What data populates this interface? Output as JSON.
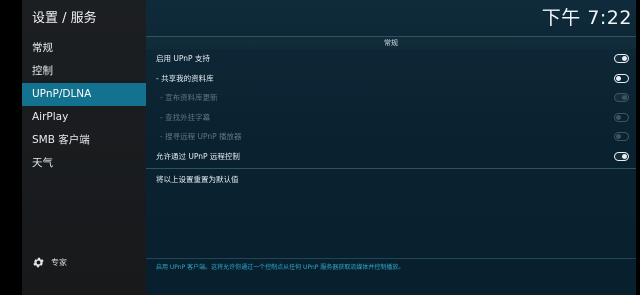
{
  "header": {
    "title": "设置 / 服务",
    "clock": "下午 7:22"
  },
  "sidebar": {
    "items": [
      {
        "label": "常规"
      },
      {
        "label": "控制"
      },
      {
        "label": "UPnP/DLNA"
      },
      {
        "label": "AirPlay"
      },
      {
        "label": "SMB 客户端"
      },
      {
        "label": "天气"
      }
    ],
    "active_index": 2,
    "settings_level": {
      "icon": "gear-icon",
      "label": "专家"
    }
  },
  "content": {
    "section_title": "常规",
    "settings": [
      {
        "label": "启用 UPnP 支持",
        "state": "on",
        "enabled": true
      },
      {
        "label": "- 共享我的资料库",
        "state": "off",
        "enabled": true
      },
      {
        "label": "- 宣布资料库更新",
        "state": "on",
        "enabled": false
      },
      {
        "label": "- 查找外挂字幕",
        "state": "off",
        "enabled": false
      },
      {
        "label": "- 搜寻远程 UPnP 播放器",
        "state": "off",
        "enabled": false
      },
      {
        "label": "允许通过 UPnP 远程控制",
        "state": "on",
        "enabled": true
      }
    ],
    "reset_label": "将以上设置重置为默认值",
    "help_text": "启用 UPnP 客户端。这将允许你通过一个控制点从任何 UPnP 服务器获取流媒体并控制播放。"
  },
  "colors": {
    "accent": "#12728f",
    "help_text": "#2fa9d0",
    "background": "#0b2331"
  }
}
